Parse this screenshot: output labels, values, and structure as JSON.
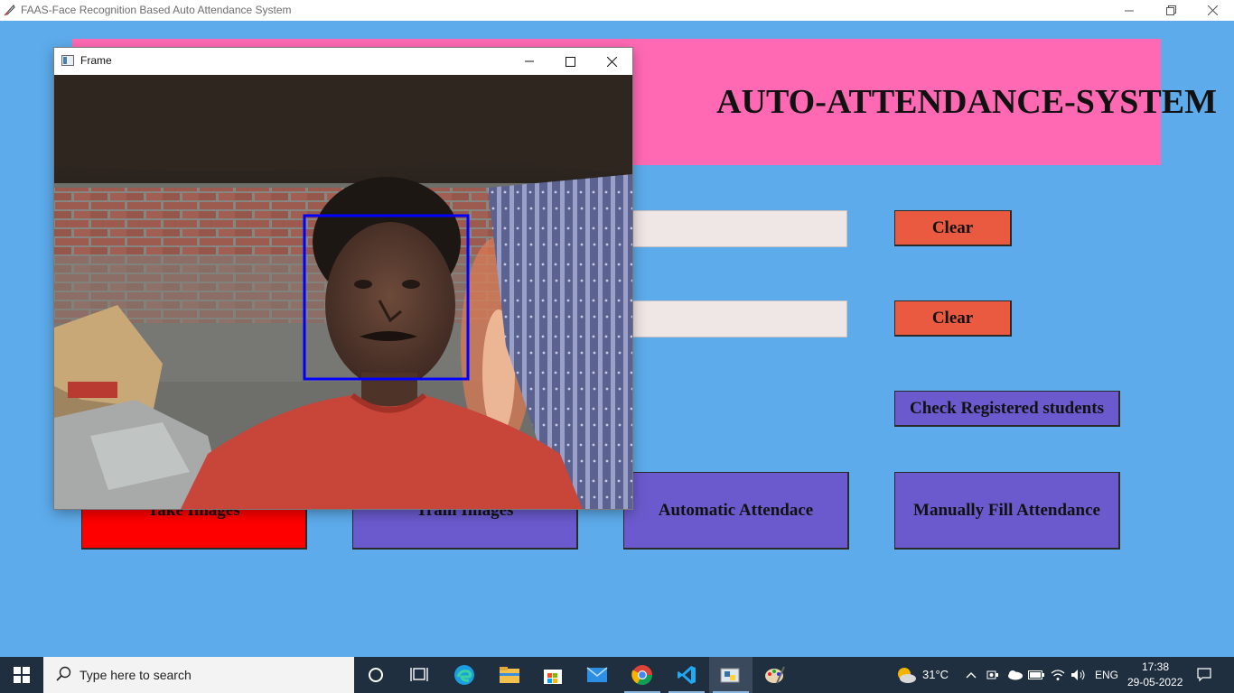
{
  "window": {
    "title": "FAAS-Face Recognition Based Auto Attendance System"
  },
  "banner": {
    "title": "AUTO-ATTENDANCE-SYSTEM"
  },
  "form": {
    "entry1_value": "",
    "entry2_value": "",
    "clear1_label": "Clear",
    "clear2_label": "Clear",
    "check_label": "Check Registered students"
  },
  "actions": {
    "take_images": "Take Images",
    "train_images": "Train Images",
    "automatic_attendance": "Automatic Attendace",
    "manual_attendance": "Manually Fill Attendance"
  },
  "frame_window": {
    "title": "Frame"
  },
  "taskbar": {
    "search_placeholder": "Type here to search",
    "apps": [
      "cortana-icon",
      "task-view-icon",
      "edge-icon",
      "file-explorer-icon",
      "store-icon",
      "mail-icon",
      "chrome-icon",
      "vscode-icon",
      "python-icon",
      "paint-icon"
    ],
    "weather": "31°C",
    "language": "ENG",
    "time": "17:38",
    "date": "29-05-2022"
  },
  "colors": {
    "background": "#5dabeb",
    "banner": "#ff69b4",
    "clear_button": "#ea5a40",
    "primary_button": "#6a5acd",
    "take_images_button": "#ff0000",
    "face_box": "#0000ff"
  }
}
